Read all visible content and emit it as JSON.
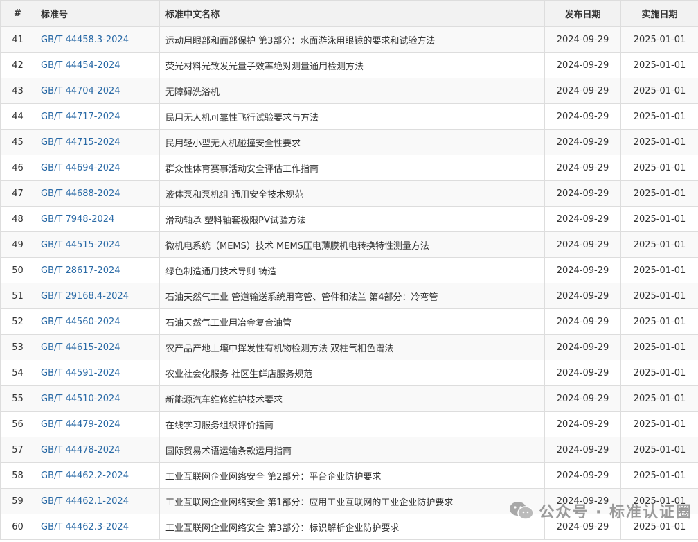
{
  "table": {
    "headers": {
      "num": "#",
      "code": "标准号",
      "name": "标准中文名称",
      "publish": "发布日期",
      "implement": "实施日期"
    },
    "rows": [
      {
        "num": "41",
        "code": "GB/T 44458.3-2024",
        "name": "运动用眼部和面部保护 第3部分：水面游泳用眼镜的要求和试验方法",
        "publish": "2024-09-29",
        "implement": "2025-01-01"
      },
      {
        "num": "42",
        "code": "GB/T 44454-2024",
        "name": "荧光材料光致发光量子效率绝对测量通用检测方法",
        "publish": "2024-09-29",
        "implement": "2025-01-01"
      },
      {
        "num": "43",
        "code": "GB/T 44704-2024",
        "name": "无障碍洗浴机",
        "publish": "2024-09-29",
        "implement": "2025-01-01"
      },
      {
        "num": "44",
        "code": "GB/T 44717-2024",
        "name": "民用无人机可靠性飞行试验要求与方法",
        "publish": "2024-09-29",
        "implement": "2025-01-01"
      },
      {
        "num": "45",
        "code": "GB/T 44715-2024",
        "name": "民用轻小型无人机碰撞安全性要求",
        "publish": "2024-09-29",
        "implement": "2025-01-01"
      },
      {
        "num": "46",
        "code": "GB/T 44694-2024",
        "name": "群众性体育赛事活动安全评估工作指南",
        "publish": "2024-09-29",
        "implement": "2025-01-01"
      },
      {
        "num": "47",
        "code": "GB/T 44688-2024",
        "name": "液体泵和泵机组 通用安全技术规范",
        "publish": "2024-09-29",
        "implement": "2025-01-01"
      },
      {
        "num": "48",
        "code": "GB/T 7948-2024",
        "name": "滑动轴承 塑料轴套极限PV试验方法",
        "publish": "2024-09-29",
        "implement": "2025-01-01"
      },
      {
        "num": "49",
        "code": "GB/T 44515-2024",
        "name": "微机电系统（MEMS）技术 MEMS压电薄膜机电转换特性测量方法",
        "publish": "2024-09-29",
        "implement": "2025-01-01"
      },
      {
        "num": "50",
        "code": "GB/T 28617-2024",
        "name": "绿色制造通用技术导则 铸造",
        "publish": "2024-09-29",
        "implement": "2025-01-01"
      },
      {
        "num": "51",
        "code": "GB/T 29168.4-2024",
        "name": "石油天然气工业 管道输送系统用弯管、管件和法兰 第4部分：冷弯管",
        "publish": "2024-09-29",
        "implement": "2025-01-01"
      },
      {
        "num": "52",
        "code": "GB/T 44560-2024",
        "name": "石油天然气工业用冶金复合油管",
        "publish": "2024-09-29",
        "implement": "2025-01-01"
      },
      {
        "num": "53",
        "code": "GB/T 44615-2024",
        "name": "农产品产地土壤中挥发性有机物检测方法 双柱气相色谱法",
        "publish": "2024-09-29",
        "implement": "2025-01-01"
      },
      {
        "num": "54",
        "code": "GB/T 44591-2024",
        "name": "农业社会化服务 社区生鲜店服务规范",
        "publish": "2024-09-29",
        "implement": "2025-01-01"
      },
      {
        "num": "55",
        "code": "GB/T 44510-2024",
        "name": "新能源汽车维修维护技术要求",
        "publish": "2024-09-29",
        "implement": "2025-01-01"
      },
      {
        "num": "56",
        "code": "GB/T 44479-2024",
        "name": "在线学习服务组织评价指南",
        "publish": "2024-09-29",
        "implement": "2025-01-01"
      },
      {
        "num": "57",
        "code": "GB/T 44478-2024",
        "name": "国际贸易术语运输条款运用指南",
        "publish": "2024-09-29",
        "implement": "2025-01-01"
      },
      {
        "num": "58",
        "code": "GB/T 44462.2-2024",
        "name": "工业互联网企业网络安全 第2部分：平台企业防护要求",
        "publish": "2024-09-29",
        "implement": "2025-01-01"
      },
      {
        "num": "59",
        "code": "GB/T 44462.1-2024",
        "name": "工业互联网企业网络安全 第1部分：应用工业互联网的工业企业防护要求",
        "publish": "2024-09-29",
        "implement": "2025-01-01"
      },
      {
        "num": "60",
        "code": "GB/T 44462.3-2024",
        "name": "工业互联网企业网络安全 第3部分：标识解析企业防护要求",
        "publish": "2024-09-29",
        "implement": "2025-01-01"
      }
    ]
  },
  "watermark": {
    "text": "公众号 · 标准认证圈",
    "icon": "wechat-icon"
  },
  "colors": {
    "link": "#2a6aa6",
    "header_bg": "#f2f2f2",
    "stripe_bg": "#f9f9f9",
    "border": "#dddddd"
  }
}
